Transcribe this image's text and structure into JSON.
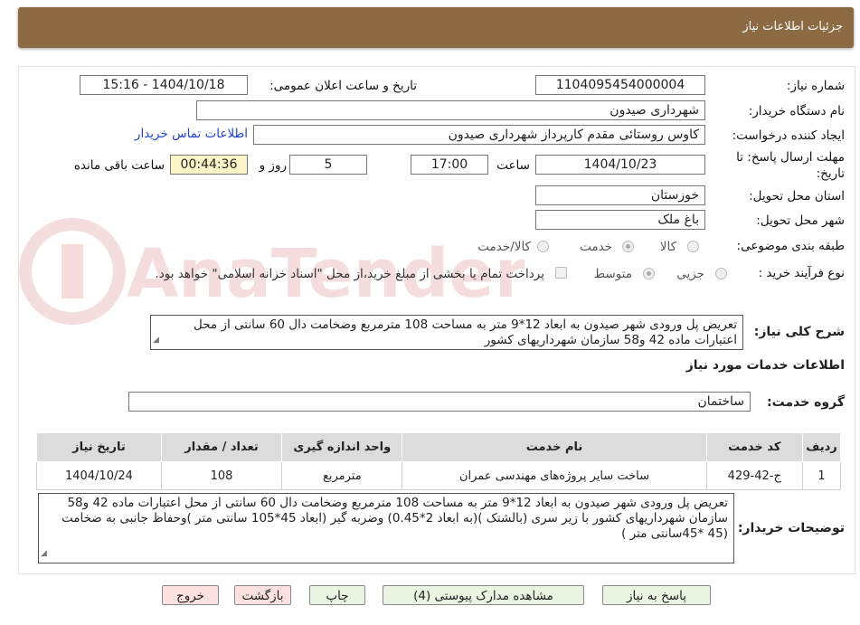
{
  "header": {
    "title": "جزئیات اطلاعات نیاز"
  },
  "form": {
    "need_number_label": "شماره نیاز:",
    "need_number": "1104095454000004",
    "announce_label": "تاریخ و ساعت اعلان عمومی:",
    "announce_value": "1404/10/18 - 15:16",
    "buyer_org_label": "نام دستگاه خریدار:",
    "buyer_org": "شهرداری صیدون",
    "creator_label": "ایجاد کننده درخواست:",
    "creator": "کاوس روستائی مقدم کارپرداز شهرداری صیدون",
    "contact_link": "اطلاعات تماس خریدار",
    "deadline_label_1": "مهلت ارسال پاسخ: تا",
    "deadline_label_2": "تاریخ:",
    "deadline_date": "1404/10/23",
    "time_label": "ساعت",
    "deadline_time": "17:00",
    "days_value": "5",
    "days_label": "روز و",
    "remaining_value": "00:44:36",
    "remaining_label": "ساعت باقی مانده",
    "province_label": "استان محل تحویل:",
    "province": "خوزستان",
    "city_label": "شهر محل تحویل:",
    "city": "باغ ملک",
    "category_label": "طبقه بندی موضوعی:",
    "category_options": [
      "کالا",
      "خدمت",
      "کالا/خدمت"
    ],
    "category_selected": "خدمت",
    "process_label": "نوع فرآیند خرید :",
    "process_options": [
      "جزیی",
      "متوسط"
    ],
    "process_selected": "متوسط",
    "treasury_note": "پرداخت تمام یا بخشی از مبلغ خرید،از محل \"اسناد خزانه اسلامی\" خواهد بود.",
    "description_label": "شرح کلی نیاز:",
    "description": "تعریض پل ورودی  شهر صیدون به ابعاد 12*9 متر  به مساحت 108 مترمربع وضخامت دال 60 سانتی از محل اعتبارات ماده 42 و58 سازمان شهرداریهای کشور"
  },
  "services": {
    "section_title": "اطلاعات خدمات مورد نیاز",
    "group_label": "گروه خدمت:",
    "group_value": "ساختمان",
    "table": {
      "headers": [
        "ردیف",
        "کد خدمت",
        "نام خدمت",
        "واحد اندازه گیری",
        "تعداد / مقدار",
        "تاریخ نیاز"
      ],
      "rows": [
        [
          "1",
          "ج-42-429",
          "ساخت سایر پروژه‌های مهندسی عمران",
          "مترمربع",
          "108",
          "1404/10/24"
        ]
      ]
    }
  },
  "buyer_notes": {
    "label": "توضیحات خریدار:",
    "text": "تعریض پل ورودی  شهر صیدون به ابعاد 12*9 متر  به مساحت 108 مترمربع وضخامت دال 60 سانتی از محل اعتبارات ماده 42 و58 سازمان شهرداریهای کشور با زیر سری (بالشتک )(به ابعاد 2*0.45) وضربه گیر (ابعاد 45*105 سانتی متر )وحفاظ جانبی به ضخامت (45 *45سانتی متر )"
  },
  "buttons": {
    "reply": "پاسخ به نیاز",
    "attachments": "مشاهده مدارک پیوستی (4)",
    "print": "چاپ",
    "back": "بازگشت",
    "exit": "خروج"
  },
  "watermark": {
    "text": "AnaTender.net"
  }
}
